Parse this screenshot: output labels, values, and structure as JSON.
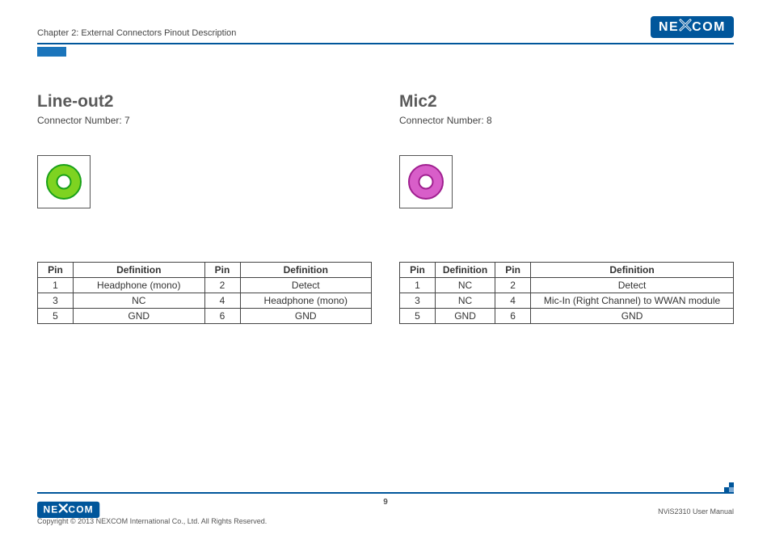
{
  "brand": "NEXCOM",
  "header": {
    "chapter": "Chapter 2: External Connectors Pinout Description"
  },
  "sections": [
    {
      "title": "Line-out2",
      "subtitle": "Connector Number: 7",
      "jack_color": "#7ed321",
      "jack_stroke": "#19a119",
      "table": {
        "headers": [
          "Pin",
          "Definition",
          "Pin",
          "Definition"
        ],
        "rows": [
          [
            "1",
            "Headphone (mono)",
            "2",
            "Detect"
          ],
          [
            "3",
            "NC",
            "4",
            "Headphone (mono)"
          ],
          [
            "5",
            "GND",
            "6",
            "GND"
          ]
        ]
      }
    },
    {
      "title": "Mic2",
      "subtitle": "Connector Number: 8",
      "jack_color": "#d85ec9",
      "jack_stroke": "#a02090",
      "table": {
        "headers": [
          "Pin",
          "Definition",
          "Pin",
          "Definition"
        ],
        "rows": [
          [
            "1",
            "NC",
            "2",
            "Detect"
          ],
          [
            "3",
            "NC",
            "4",
            "Mic-In (Right Channel) to WWAN module"
          ],
          [
            "5",
            "GND",
            "6",
            "GND"
          ]
        ]
      }
    }
  ],
  "footer": {
    "copyright": "Copyright © 2013 NEXCOM International Co., Ltd. All Rights Reserved.",
    "page_number": "9",
    "manual": "NViS2310 User Manual"
  }
}
